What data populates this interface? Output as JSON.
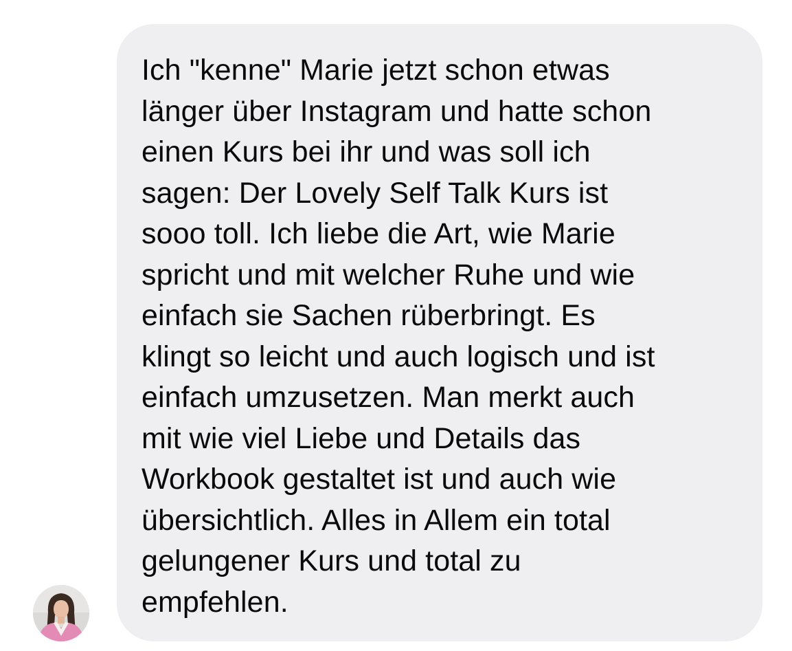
{
  "message": {
    "text": "Ich \"kenne\" Marie jetzt schon etwas\nlänger über Instagram und hatte schon\neinen Kurs bei ihr und was soll ich\nsagen: Der Lovely Self Talk Kurs ist\nsooo toll. Ich liebe die Art, wie Marie\nspricht und mit welcher Ruhe und wie\neinfach sie Sachen rüberbringt. Es\nklingt so leicht und auch logisch und ist\neinfach umzusetzen. Man merkt auch\nmit wie viel Liebe und Details das\nWorkbook gestaltet ist und auch wie\nübersichtlich. Alles in Allem ein total\ngelungener Kurs und total zu\nempfehlen."
  },
  "colors": {
    "bubble_background": "#efeff1",
    "text": "#0a0a0a",
    "page_background": "#ffffff"
  },
  "avatar": {
    "icon": "profile-photo"
  }
}
